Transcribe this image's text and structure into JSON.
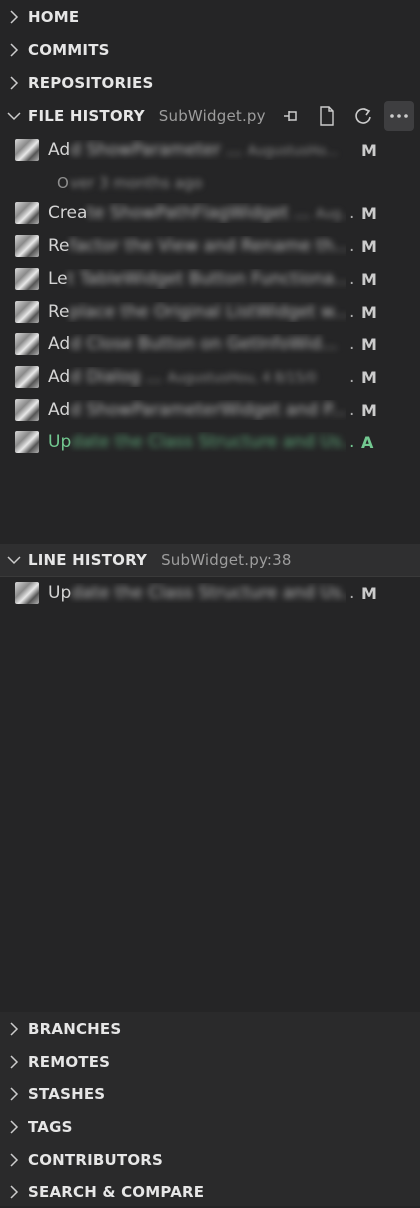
{
  "sections_top": [
    {
      "label": "HOME"
    },
    {
      "label": "COMMITS"
    },
    {
      "label": "REPOSITORIES"
    }
  ],
  "file_history": {
    "label": "FILE HISTORY",
    "file": "SubWidget.py",
    "actions": [
      "pin-icon",
      "file-icon",
      "refresh-icon",
      "more-icon"
    ],
    "commits": [
      {
        "prefix": "Ad",
        "rest": "d ShowParameter ...",
        "meta": "AugustusHo...",
        "status": "M",
        "added": false
      },
      {
        "prefix": "Crea",
        "rest": "te ShowPathFlagWidget ...",
        "meta": "Aug...",
        "status": "M",
        "added": false
      },
      {
        "prefix": "Re",
        "rest": "factor the View and Rename th...",
        "meta": "",
        "status": "M",
        "added": false
      },
      {
        "prefix": "Le",
        "rest": "t TableWidget Button Functiona...",
        "meta": "",
        "status": "M",
        "added": false
      },
      {
        "prefix": "Re",
        "rest": "place the Original ListWidget w...",
        "meta": "",
        "status": "M",
        "added": false
      },
      {
        "prefix": "Ad",
        "rest": "d Close Button on GetInfoWid...",
        "meta": "",
        "status": "M",
        "added": false
      },
      {
        "prefix": "Ad",
        "rest": "d Dialog ...",
        "meta": "AugustusHou, 4 8/15/0",
        "status": "M",
        "added": false
      },
      {
        "prefix": "Ad",
        "rest": "d ShowParameterWidget and P...",
        "meta": "",
        "status": "M",
        "added": false
      },
      {
        "prefix": "Up",
        "rest": "date the Class Structure and Us...",
        "meta": "",
        "status": "A",
        "added": true
      }
    ],
    "time_group": {
      "prefix": "O",
      "rest": "ver 3 months ago"
    }
  },
  "line_history": {
    "label": "LINE HISTORY",
    "file": "SubWidget.py:38",
    "commits": [
      {
        "prefix": "Up",
        "rest": "date the Class Structure and Us...",
        "status": "M"
      }
    ]
  },
  "sections_bottom": [
    {
      "label": "BRANCHES"
    },
    {
      "label": "REMOTES"
    },
    {
      "label": "STASHES"
    },
    {
      "label": "TAGS"
    },
    {
      "label": "CONTRIBUTORS"
    },
    {
      "label": "SEARCH & COMPARE"
    }
  ],
  "colors": {
    "background": "#252526",
    "added": "#73c991",
    "text": "#cccccc"
  }
}
